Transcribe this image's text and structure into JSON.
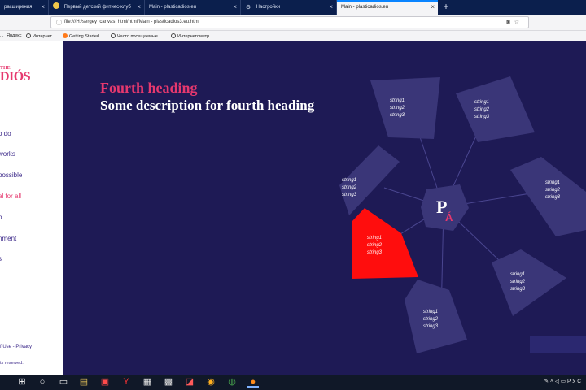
{
  "browser": {
    "tabs": [
      {
        "label": "расширения",
        "icon": "puzzle-icon",
        "active": false
      },
      {
        "label": "Первый детский фитнес-клуб",
        "icon": "favicon-icon",
        "active": false
      },
      {
        "label": "Main - plasticadios.eu",
        "icon": "page-icon",
        "active": false
      },
      {
        "label": "Настройки",
        "icon": "gear-icon",
        "active": false
      },
      {
        "label": "Main - plasticadios.eu",
        "icon": "page-icon",
        "active": true
      }
    ],
    "new_tab": "+",
    "close_glyph": "×",
    "url": "file:///H:/sergey_canvas_html/html/Main - plasticadios3.eu.html",
    "bookmarks": [
      {
        "label": "Яндекс",
        "icon": "yandex-icon"
      },
      {
        "label": "Интернет",
        "icon": "globe-icon"
      },
      {
        "label": "Getting Started",
        "icon": "firefox-icon"
      },
      {
        "label": "Часто посещаемые",
        "icon": "globe-icon"
      },
      {
        "label": "Интернетометр",
        "icon": "globe-icon"
      }
    ],
    "bookmark_prefix": "..."
  },
  "sidebar": {
    "logo_top": "THE",
    "logo_main": "DIÓS",
    "nav": [
      {
        "label": "o do",
        "active": false
      },
      {
        "label": "works",
        "active": false
      },
      {
        "label": "possible",
        "active": false
      },
      {
        "label": "al for all",
        "active": true
      },
      {
        "label": "p",
        "active": false
      },
      {
        "label": "nment",
        "active": false
      },
      {
        "label": "s",
        "active": false
      }
    ],
    "footer_terms": "f Use",
    "footer_sep": " - ",
    "footer_privacy": "Privacy",
    "footer_rights": "ts reserved."
  },
  "main": {
    "heading": "Fourth heading",
    "description": "Some description for fourth heading",
    "center_logo": "PA",
    "nodes": [
      {
        "lines": [
          "string1",
          "string2",
          "string3"
        ],
        "selected": false
      },
      {
        "lines": [
          "string1",
          "string2",
          "string3"
        ],
        "selected": false
      },
      {
        "lines": [
          "string1",
          "string2",
          "string3"
        ],
        "selected": false
      },
      {
        "lines": [
          "string1",
          "string2",
          "string3"
        ],
        "selected": false
      },
      {
        "lines": [
          "string1",
          "string2",
          "string3"
        ],
        "selected": true
      },
      {
        "lines": [
          "string1",
          "string2",
          "string3"
        ],
        "selected": false
      },
      {
        "lines": [
          "string1",
          "string2",
          "string3"
        ],
        "selected": false
      }
    ]
  },
  "colors": {
    "accent": "#e6386e",
    "background": "#1e1a55",
    "node": "#3a3678",
    "selected": "#ff0d0d"
  },
  "taskbar": {
    "icons": [
      "windows-icon",
      "cortana-icon",
      "task-view-icon",
      "explorer-icon",
      "gift-icon",
      "yandex-icon",
      "calculator-icon",
      "media-icon",
      "pdf-icon",
      "record-icon",
      "chrome-icon",
      "firefox-icon"
    ],
    "tray_lang": "РУС"
  }
}
